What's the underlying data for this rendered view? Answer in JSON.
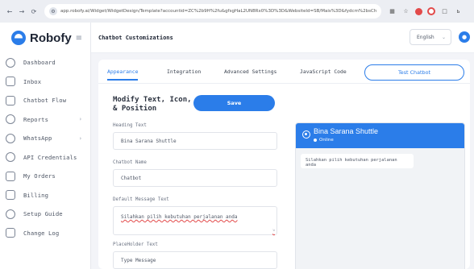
{
  "browser": {
    "url": "app.robofy.ai/Widget/WidgetDesign/Template?accountid=ZC%2b9H%2fu&gfsgHaL2UN8Rx0%3D%3D&WebsiteId=SB/Mais%3D&fydcm%2bsChanw...",
    "colors": {
      "accent": "#e24a4a"
    }
  },
  "sidebar": {
    "logo": "Robofy",
    "items": [
      {
        "label": "Dashboard",
        "icon": "dashboard-icon",
        "has_chevron": false
      },
      {
        "label": "Inbox",
        "icon": "inbox-icon",
        "has_chevron": false
      },
      {
        "label": "Chatbot Flow",
        "icon": "flow-icon",
        "has_chevron": false
      },
      {
        "label": "Reports",
        "icon": "reports-icon",
        "has_chevron": true
      },
      {
        "label": "WhatsApp",
        "icon": "whatsapp-icon",
        "has_chevron": true
      },
      {
        "label": "API Credentials",
        "icon": "api-key-icon",
        "has_chevron": false
      },
      {
        "label": "My Orders",
        "icon": "cart-icon",
        "has_chevron": false
      },
      {
        "label": "Billing",
        "icon": "billing-icon",
        "has_chevron": false
      },
      {
        "label": "Setup Guide",
        "icon": "guide-icon",
        "has_chevron": false
      },
      {
        "label": "Change Log",
        "icon": "changelog-icon",
        "has_chevron": false
      }
    ]
  },
  "header": {
    "title": "Chatbot Customizations",
    "language": "English"
  },
  "tabs": [
    {
      "label": "Appearance",
      "active": true
    },
    {
      "label": "Integration",
      "active": false
    },
    {
      "label": "Advanced Settings",
      "active": false
    },
    {
      "label": "JavaScript Code",
      "active": false
    }
  ],
  "test_button": "Test Chatbot",
  "form": {
    "section_title": "Modify Text, Icon, & Position",
    "save_label": "Save",
    "heading_label": "Heading Text",
    "heading_value": "Bina Sarana Shuttle",
    "name_label": "Chatbot Name",
    "name_value": "Chatbot",
    "default_label": "Default Message Text",
    "default_value": "Silahkan pilih kebutuhan perjalanan anda",
    "placeholder_label": "PlaceHolder Text",
    "placeholder_value": "Type Message"
  },
  "preview": {
    "name": "Bina Sarana Shuttle",
    "status": "Online",
    "message": "Silahkan pilih kebutuhan perjalanan anda",
    "colors": {
      "brand": "#2b7de9"
    }
  }
}
